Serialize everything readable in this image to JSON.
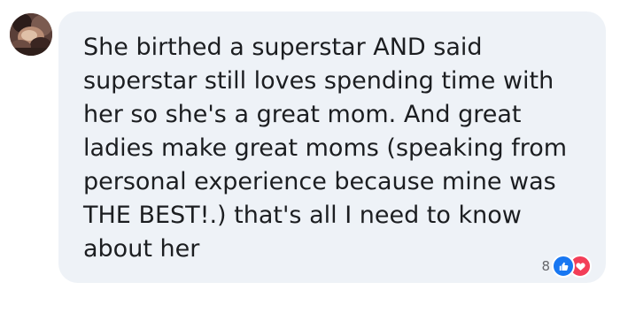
{
  "comment": {
    "text": "She birthed a superstar AND said superstar still loves spending time with her so she's a great mom. And great ladies make great moms (speaking from personal experience because mine was THE BEST!.) that's all I need to know about her"
  },
  "reactions": {
    "count": "8",
    "icons": [
      "like-icon",
      "love-icon"
    ],
    "colors": {
      "like": "#1877f2",
      "love": "#f33e58"
    }
  },
  "colors": {
    "bubble_background": "#eef2f7",
    "text": "#1c1e21",
    "meta_text": "#65676b"
  }
}
